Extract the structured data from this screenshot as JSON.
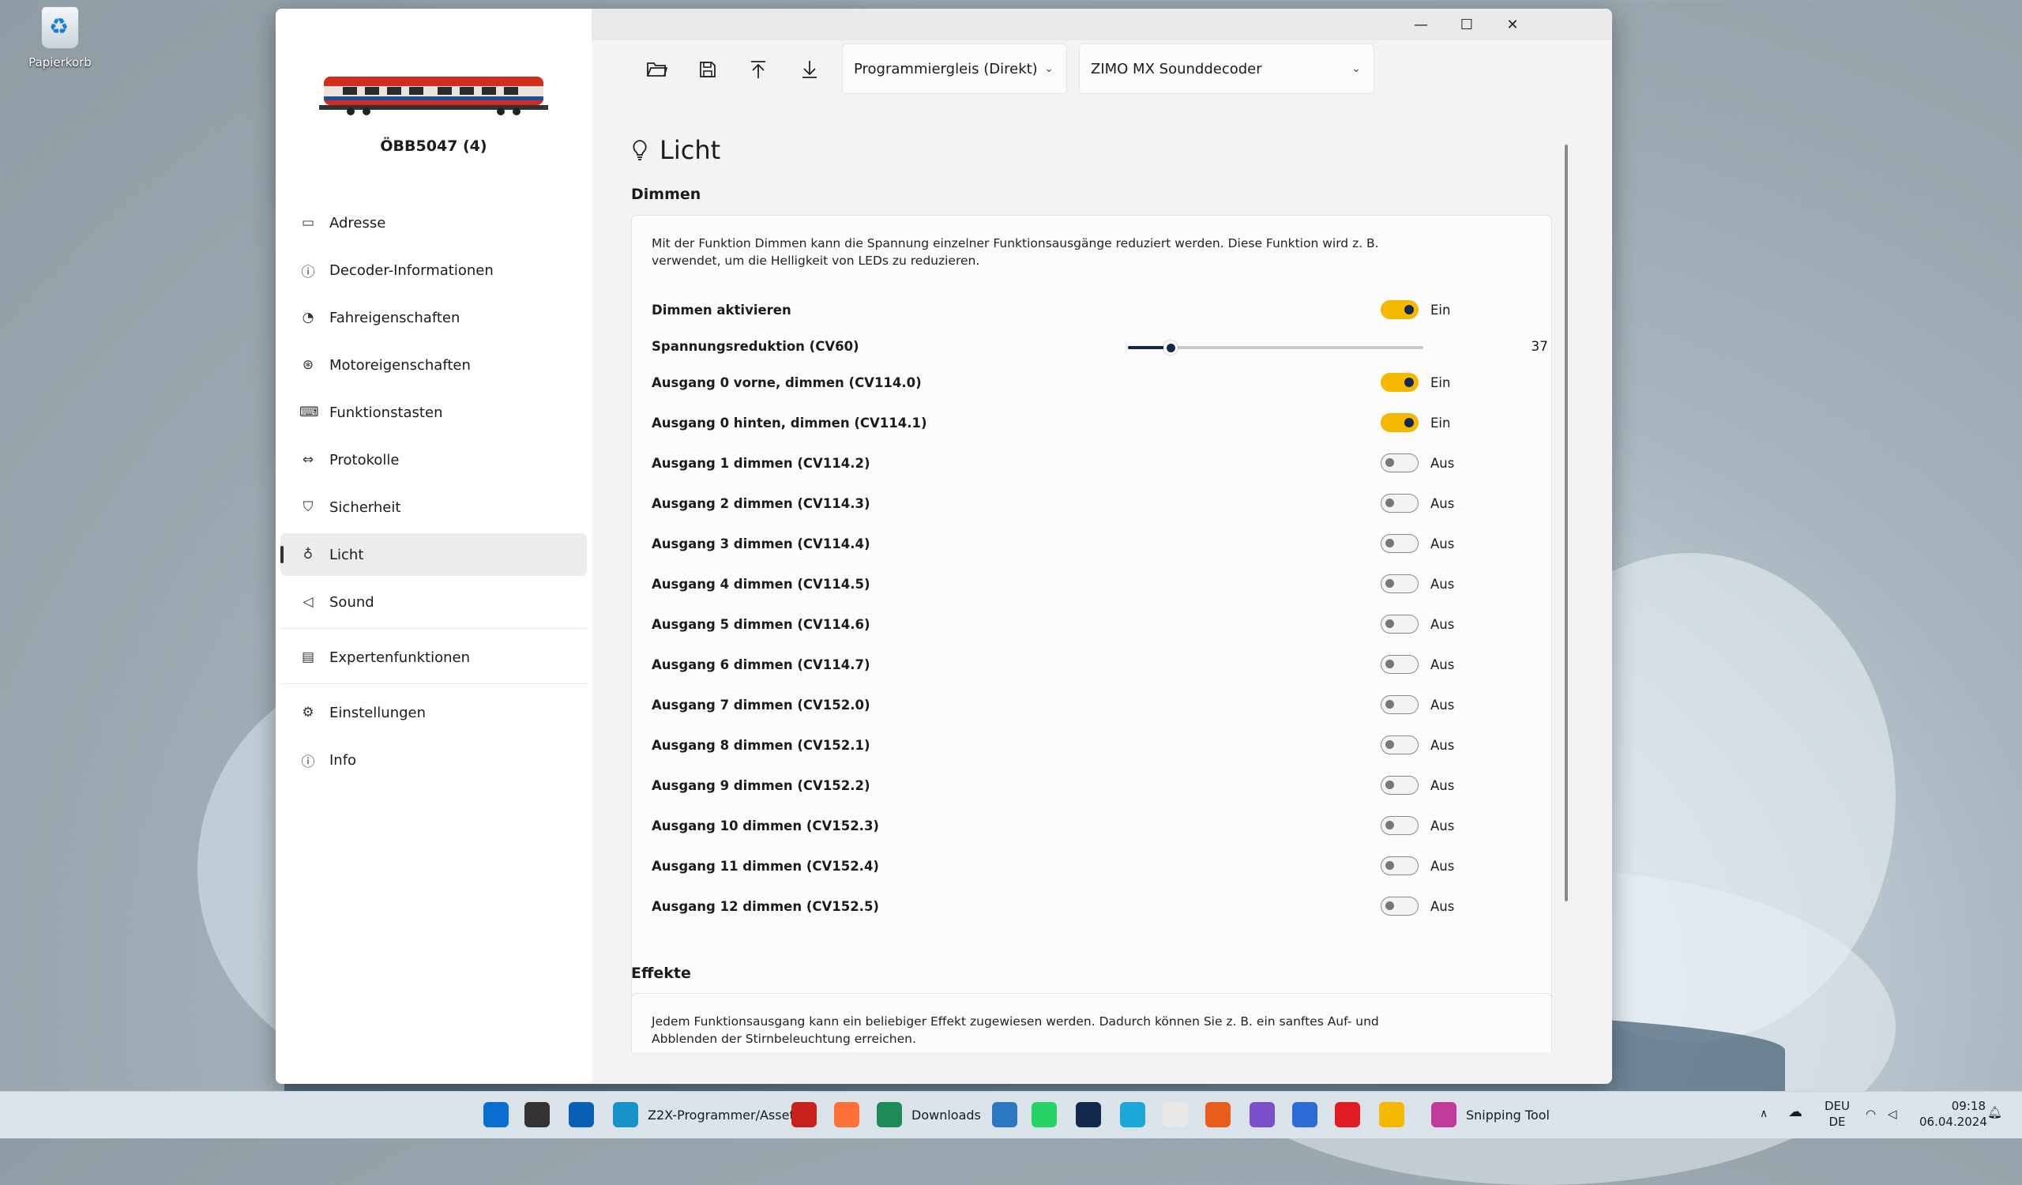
{
  "desktop": {
    "recycle_bin_label": "Papierkorb"
  },
  "window": {
    "loco_name": "ÖBB5047 (4)",
    "controls": {
      "minimize": "—",
      "maximize": "☐",
      "close": "✕"
    }
  },
  "sidebar": {
    "items": [
      {
        "label": "Adresse",
        "icon": "address-card-icon"
      },
      {
        "label": "Decoder-Informationen",
        "icon": "info-icon"
      },
      {
        "label": "Fahreigenschaften",
        "icon": "speedometer-icon"
      },
      {
        "label": "Motoreigenschaften",
        "icon": "motor-icon"
      },
      {
        "label": "Funktionstasten",
        "icon": "keyboard-icon"
      },
      {
        "label": "Protokolle",
        "icon": "arrows-icon"
      },
      {
        "label": "Sicherheit",
        "icon": "shield-icon"
      },
      {
        "label": "Licht",
        "icon": "lightbulb-icon",
        "active": true
      },
      {
        "label": "Sound",
        "icon": "speaker-icon"
      },
      {
        "label": "Expertenfunktionen",
        "icon": "toolbox-icon"
      },
      {
        "label": "Einstellungen",
        "icon": "gear-icon"
      },
      {
        "label": "Info",
        "icon": "info-icon"
      }
    ]
  },
  "toolbar": {
    "track_select": "Programmiergleis (Direkt)",
    "decoder_select": "ZIMO MX Sounddecoder"
  },
  "content": {
    "title": "Licht",
    "dimmen": {
      "section_title": "Dimmen",
      "description": "Mit der Funktion Dimmen kann die Spannung einzelner Funktionsausgänge reduziert werden. Diese Funktion wird z. B. verwendet, um die Helligkeit von LEDs zu reduzieren.",
      "enable": {
        "label": "Dimmen aktivieren",
        "state": "Ein",
        "on": true
      },
      "slider": {
        "label": "Spannungsreduktion (CV60)",
        "value": 37,
        "min": 0,
        "max": 255
      },
      "outputs": [
        {
          "label": "Ausgang 0 vorne, dimmen (CV114.0)",
          "state": "Ein",
          "on": true
        },
        {
          "label": "Ausgang 0 hinten, dimmen (CV114.1)",
          "state": "Ein",
          "on": true
        },
        {
          "label": "Ausgang 1 dimmen (CV114.2)",
          "state": "Aus",
          "on": false
        },
        {
          "label": "Ausgang 2 dimmen (CV114.3)",
          "state": "Aus",
          "on": false
        },
        {
          "label": "Ausgang 3 dimmen (CV114.4)",
          "state": "Aus",
          "on": false
        },
        {
          "label": "Ausgang 4 dimmen (CV114.5)",
          "state": "Aus",
          "on": false
        },
        {
          "label": "Ausgang 5 dimmen (CV114.6)",
          "state": "Aus",
          "on": false
        },
        {
          "label": "Ausgang 6 dimmen (CV114.7)",
          "state": "Aus",
          "on": false
        },
        {
          "label": "Ausgang 7 dimmen (CV152.0)",
          "state": "Aus",
          "on": false
        },
        {
          "label": "Ausgang 8 dimmen (CV152.1)",
          "state": "Aus",
          "on": false
        },
        {
          "label": "Ausgang 9 dimmen (CV152.2)",
          "state": "Aus",
          "on": false
        },
        {
          "label": "Ausgang 10 dimmen (CV152.3)",
          "state": "Aus",
          "on": false
        },
        {
          "label": "Ausgang 11 dimmen (CV152.4)",
          "state": "Aus",
          "on": false
        },
        {
          "label": "Ausgang 12 dimmen (CV152.5)",
          "state": "Aus",
          "on": false
        }
      ]
    },
    "effekte": {
      "section_title": "Effekte",
      "description": "Jedem Funktionsausgang kann ein beliebiger Effekt zugewiesen werden. Dadurch können Sie z. B. ein sanftes Auf- und Abblenden der Stirnbeleuchtung erreichen."
    }
  },
  "taskbar": {
    "apps": [
      {
        "icon": "start-icon",
        "color": "#0a6ed1"
      },
      {
        "icon": "taskview-icon",
        "color": "#333333"
      },
      {
        "icon": "outlook-icon",
        "color": "#0a5fb4"
      },
      {
        "icon": "edge-icon",
        "color": "#1593c9",
        "label": "Z2X-Programmer/Asset"
      },
      {
        "icon": "acrobat-icon",
        "color": "#c9211e"
      },
      {
        "icon": "firefox-icon",
        "color": "#ff7139"
      },
      {
        "icon": "downloads-icon",
        "color": "#1e8a5a",
        "label": "Downloads"
      },
      {
        "icon": "maps-icon",
        "color": "#2b78c2"
      },
      {
        "icon": "whatsapp-icon",
        "color": "#25d366"
      },
      {
        "icon": "app-icon",
        "color": "#13294b"
      },
      {
        "icon": "app-icon",
        "color": "#1aa7d8"
      },
      {
        "icon": "app-icon",
        "color": "#e8e8e8"
      },
      {
        "icon": "app-icon",
        "color": "#e85c1c"
      },
      {
        "icon": "visualstudio-icon",
        "color": "#7b4fc9"
      },
      {
        "icon": "app-icon",
        "color": "#2a6bd6"
      },
      {
        "icon": "app-icon",
        "color": "#e01b24"
      },
      {
        "icon": "app-icon",
        "color": "#f5b800"
      },
      {
        "icon": "snipping-tool-icon",
        "color": "#c1399a",
        "label": "Snipping Tool"
      }
    ],
    "tray": {
      "lang": "DEU",
      "lang_sub": "DE",
      "time": "09:18",
      "date": "06.04.2024"
    }
  }
}
